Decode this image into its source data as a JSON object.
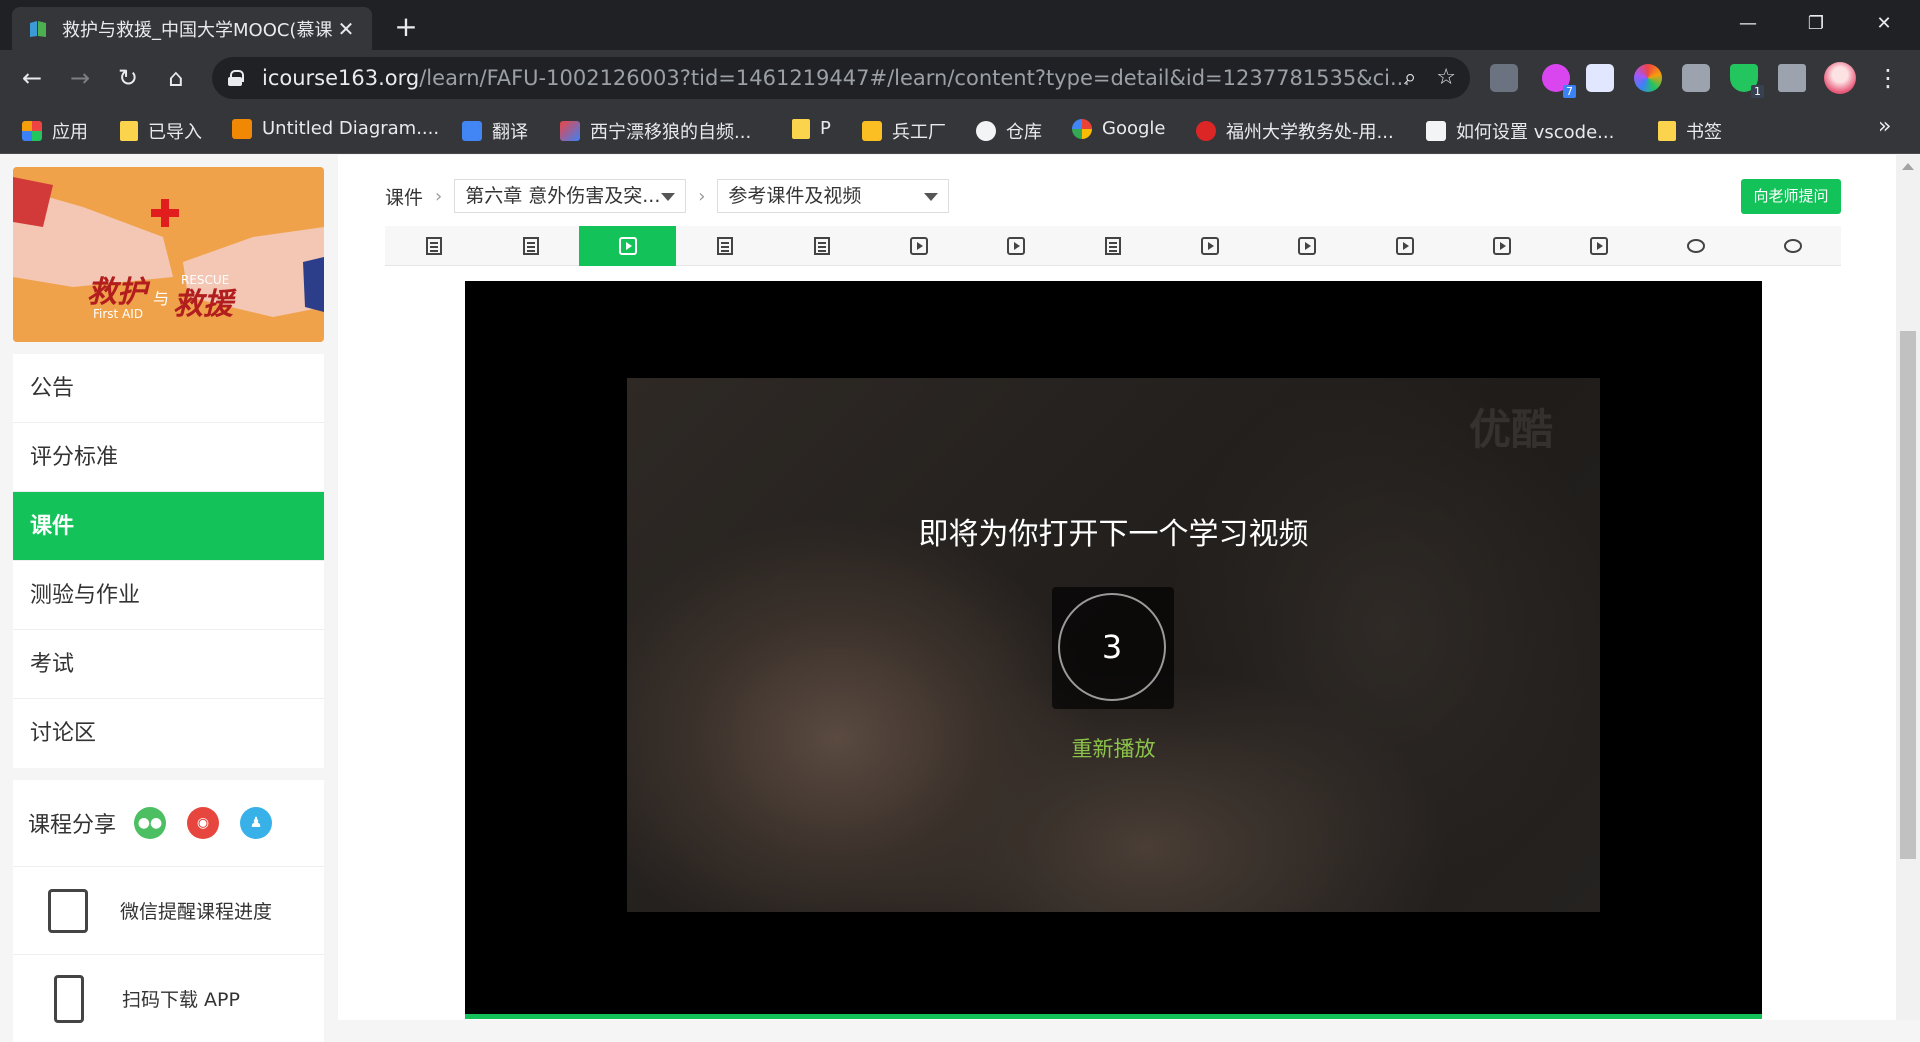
{
  "browser": {
    "tab_title": "救护与救援_中国大学MOOC(慕课)",
    "tab_close": "✕",
    "new_tab": "+",
    "url_host": "icourse163.org",
    "url_path": "/learn/FAFU-1002126003?tid=1461219447#/learn/content?type=detail&id=1237781535&ci...",
    "window_controls": {
      "minimize": "—",
      "restore": "❐",
      "close": "✕"
    },
    "ext_badges": {
      "cat": "7",
      "shield": "1"
    }
  },
  "bookmarks": [
    {
      "label": "应用",
      "icon": "apps-grid-icon"
    },
    {
      "label": "已导入",
      "icon": "folder-icon"
    },
    {
      "label": "Untitled Diagram....",
      "icon": "drawio-icon"
    },
    {
      "label": "翻译",
      "icon": "translate-icon"
    },
    {
      "label": "西宁漂移狼的自频...",
      "icon": "bilibili-icon"
    },
    {
      "label": "P",
      "icon": "folder-icon"
    },
    {
      "label": "兵工厂",
      "icon": "tools-icon"
    },
    {
      "label": "仓库",
      "icon": "github-icon"
    },
    {
      "label": "Google",
      "icon": "google-icon"
    },
    {
      "label": "福州大学教务处-用...",
      "icon": "fzu-icon"
    },
    {
      "label": "如何设置 vscode...",
      "icon": "vscode-icon"
    },
    {
      "label": "书签",
      "icon": "folder-icon"
    }
  ],
  "bookmarks_overflow": "»",
  "sidebar": {
    "nav": [
      "公告",
      "评分标准",
      "课件",
      "测验与作业",
      "考试",
      "讨论区"
    ],
    "active_nav": "课件",
    "share_label": "课程分享",
    "cover_text": {
      "line1": "救护",
      "mid": "与",
      "line2": "救援",
      "en1": "First AID",
      "en2": "RESCUE"
    },
    "tools": [
      {
        "label": "微信提醒课程进度",
        "icon": "wechat-reminder-icon"
      },
      {
        "label": "扫码下载 APP",
        "icon": "mobile-app-icon"
      }
    ]
  },
  "content": {
    "breadcrumb_root": "课件",
    "chapter_select": "第六章 意外伤害及突...",
    "lesson_select": "参考课件及视频",
    "ask_teacher": "向老师提问",
    "unit_tabs": [
      "doc",
      "doc",
      "video",
      "doc",
      "doc",
      "video",
      "video",
      "doc",
      "video",
      "video",
      "video",
      "video",
      "video",
      "chat",
      "chat"
    ],
    "active_unit": 2
  },
  "player": {
    "message": "即将为你打开下一个学习视频",
    "countdown": "3",
    "replay": "重新播放",
    "watermark": "优酷"
  }
}
